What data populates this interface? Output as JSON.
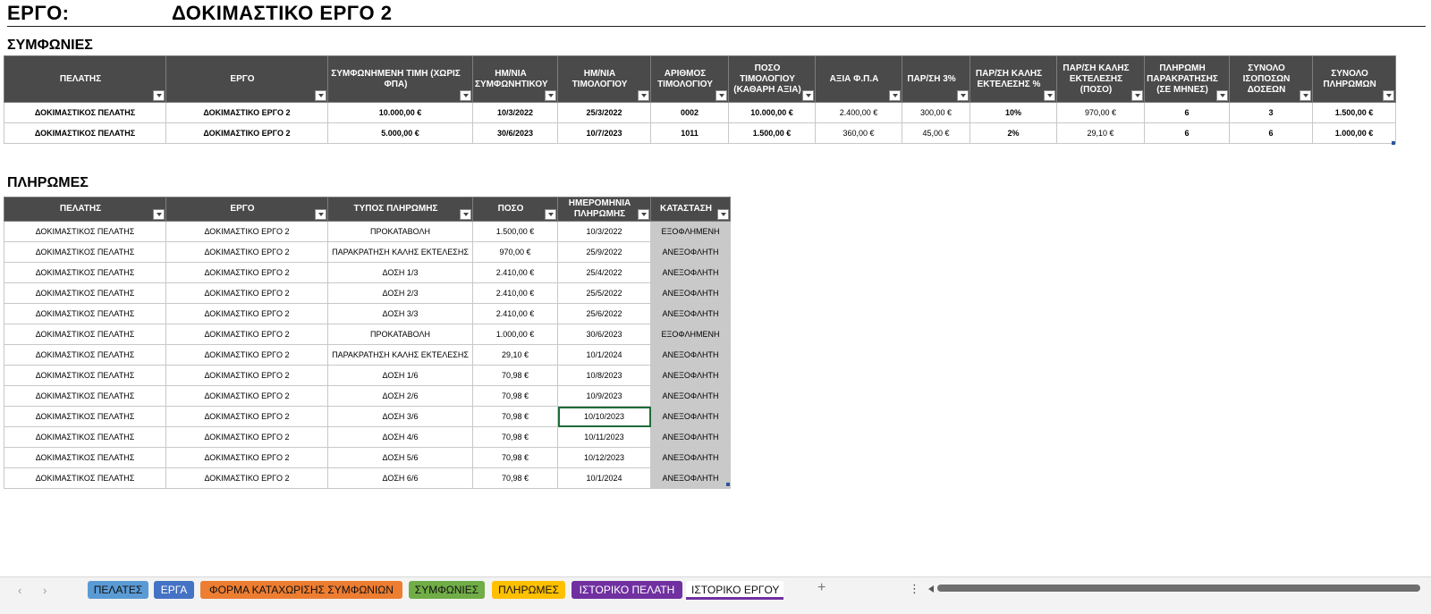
{
  "header": {
    "label": "ΕΡΓΟ:",
    "value": "ΔΟΚΙΜΑΣΤΙΚΟ ΕΡΓΟ 2"
  },
  "agreements": {
    "title": "ΣΥΜΦΩΝΙΕΣ",
    "columns": [
      "ΠΕΛΑΤΗΣ",
      "ΕΡΓΟ",
      "ΣΥΜΦΩΝΗΜΕΝΗ ΤΙΜΗ (ΧΩΡΙΣ ΦΠΑ)",
      "ΗΜ/ΝΙΑ ΣΥΜΦΩΝΗΤΙΚΟΥ",
      "ΗΜ/ΝΙΑ ΤΙΜΟΛΟΓΙΟΥ",
      "ΑΡΙΘΜΟΣ ΤΙΜΟΛΟΓΙΟΥ",
      "ΠΟΣΟ ΤΙΜΟΛΟΓΙΟΥ (ΚΑΘΑΡΗ ΑΞΙΑ)",
      "ΑΞΙΑ Φ.Π.Α",
      "ΠΑΡ/ΣΗ 3%",
      "ΠΑΡ/ΣΗ ΚΑΛΗΣ ΕΚΤΕΛΕΣΗΣ %",
      "ΠΑΡ/ΣΗ ΚΑΛΗΣ ΕΚΤΕΛΕΣΗΣ (ΠΟΣΟ)",
      "ΠΛΗΡΩΜΗ ΠΑΡΑΚΡΑΤΗΣΗΣ (ΣΕ ΜΗΝΕΣ)",
      "ΣΥΝΟΛΟ ΙΣΟΠΟΣΩΝ ΔΟΣΕΩΝ",
      "ΣΥΝΟΛΟ ΠΛΗΡΩΜΩΝ"
    ],
    "rows": [
      [
        "ΔΟΚΙΜΑΣΤΙΚΟΣ ΠΕΛΑΤΗΣ",
        "ΔΟΚΙΜΑΣΤΙΚΟ ΕΡΓΟ 2",
        "10.000,00 €",
        "10/3/2022",
        "25/3/2022",
        "0002",
        "10.000,00 €",
        "2.400,00 €",
        "300,00 €",
        "10%",
        "970,00 €",
        "6",
        "3",
        "1.500,00 €"
      ],
      [
        "ΔΟΚΙΜΑΣΤΙΚΟΣ ΠΕΛΑΤΗΣ",
        "ΔΟΚΙΜΑΣΤΙΚΟ ΕΡΓΟ 2",
        "5.000,00 €",
        "30/6/2023",
        "10/7/2023",
        "1011",
        "1.500,00 €",
        "360,00 €",
        "45,00 €",
        "2%",
        "29,10 €",
        "6",
        "6",
        "1.000,00 €"
      ]
    ]
  },
  "payments": {
    "title": "ΠΛΗΡΩΜΕΣ",
    "columns": [
      "ΠΕΛΑΤΗΣ",
      "ΕΡΓΟ",
      "ΤΥΠΟΣ ΠΛΗΡΩΜΗΣ",
      "ΠΟΣΟ",
      "ΗΜΕΡΟΜΗΝΙΑ ΠΛΗΡΩΜΗΣ",
      "ΚΑΤΑΣΤΑΣΗ"
    ],
    "rows": [
      [
        "ΔΟΚΙΜΑΣΤΙΚΟΣ ΠΕΛΑΤΗΣ",
        "ΔΟΚΙΜΑΣΤΙΚΟ ΕΡΓΟ 2",
        "ΠΡΟΚΑΤΑΒΟΛΗ",
        "1.500,00 €",
        "10/3/2022",
        "ΕΞΟΦΛΗΜΕΝΗ"
      ],
      [
        "ΔΟΚΙΜΑΣΤΙΚΟΣ ΠΕΛΑΤΗΣ",
        "ΔΟΚΙΜΑΣΤΙΚΟ ΕΡΓΟ 2",
        "ΠΑΡΑΚΡΑΤΗΣΗ ΚΑΛΗΣ ΕΚΤΕΛΕΣΗΣ",
        "970,00 €",
        "25/9/2022",
        "ΑΝΕΞΟΦΛΗΤΗ"
      ],
      [
        "ΔΟΚΙΜΑΣΤΙΚΟΣ ΠΕΛΑΤΗΣ",
        "ΔΟΚΙΜΑΣΤΙΚΟ ΕΡΓΟ 2",
        "ΔΟΣΗ 1/3",
        "2.410,00 €",
        "25/4/2022",
        "ΑΝΕΞΟΦΛΗΤΗ"
      ],
      [
        "ΔΟΚΙΜΑΣΤΙΚΟΣ ΠΕΛΑΤΗΣ",
        "ΔΟΚΙΜΑΣΤΙΚΟ ΕΡΓΟ 2",
        "ΔΟΣΗ 2/3",
        "2.410,00 €",
        "25/5/2022",
        "ΑΝΕΞΟΦΛΗΤΗ"
      ],
      [
        "ΔΟΚΙΜΑΣΤΙΚΟΣ ΠΕΛΑΤΗΣ",
        "ΔΟΚΙΜΑΣΤΙΚΟ ΕΡΓΟ 2",
        "ΔΟΣΗ 3/3",
        "2.410,00 €",
        "25/6/2022",
        "ΑΝΕΞΟΦΛΗΤΗ"
      ],
      [
        "ΔΟΚΙΜΑΣΤΙΚΟΣ ΠΕΛΑΤΗΣ",
        "ΔΟΚΙΜΑΣΤΙΚΟ ΕΡΓΟ 2",
        "ΠΡΟΚΑΤΑΒΟΛΗ",
        "1.000,00 €",
        "30/6/2023",
        "ΕΞΟΦΛΗΜΕΝΗ"
      ],
      [
        "ΔΟΚΙΜΑΣΤΙΚΟΣ ΠΕΛΑΤΗΣ",
        "ΔΟΚΙΜΑΣΤΙΚΟ ΕΡΓΟ 2",
        "ΠΑΡΑΚΡΑΤΗΣΗ ΚΑΛΗΣ ΕΚΤΕΛΕΣΗΣ",
        "29,10 €",
        "10/1/2024",
        "ΑΝΕΞΟΦΛΗΤΗ"
      ],
      [
        "ΔΟΚΙΜΑΣΤΙΚΟΣ ΠΕΛΑΤΗΣ",
        "ΔΟΚΙΜΑΣΤΙΚΟ ΕΡΓΟ 2",
        "ΔΟΣΗ 1/6",
        "70,98 €",
        "10/8/2023",
        "ΑΝΕΞΟΦΛΗΤΗ"
      ],
      [
        "ΔΟΚΙΜΑΣΤΙΚΟΣ ΠΕΛΑΤΗΣ",
        "ΔΟΚΙΜΑΣΤΙΚΟ ΕΡΓΟ 2",
        "ΔΟΣΗ 2/6",
        "70,98 €",
        "10/9/2023",
        "ΑΝΕΞΟΦΛΗΤΗ"
      ],
      [
        "ΔΟΚΙΜΑΣΤΙΚΟΣ ΠΕΛΑΤΗΣ",
        "ΔΟΚΙΜΑΣΤΙΚΟ ΕΡΓΟ 2",
        "ΔΟΣΗ 3/6",
        "70,98 €",
        "10/10/2023",
        "ΑΝΕΞΟΦΛΗΤΗ"
      ],
      [
        "ΔΟΚΙΜΑΣΤΙΚΟΣ ΠΕΛΑΤΗΣ",
        "ΔΟΚΙΜΑΣΤΙΚΟ ΕΡΓΟ 2",
        "ΔΟΣΗ 4/6",
        "70,98 €",
        "10/11/2023",
        "ΑΝΕΞΟΦΛΗΤΗ"
      ],
      [
        "ΔΟΚΙΜΑΣΤΙΚΟΣ ΠΕΛΑΤΗΣ",
        "ΔΟΚΙΜΑΣΤΙΚΟ ΕΡΓΟ 2",
        "ΔΟΣΗ 5/6",
        "70,98 €",
        "10/12/2023",
        "ΑΝΕΞΟΦΛΗΤΗ"
      ],
      [
        "ΔΟΚΙΜΑΣΤΙΚΟΣ ΠΕΛΑΤΗΣ",
        "ΔΟΚΙΜΑΣΤΙΚΟ ΕΡΓΟ 2",
        "ΔΟΣΗ 6/6",
        "70,98 €",
        "10/1/2024",
        "ΑΝΕΞΟΦΛΗΤΗ"
      ]
    ],
    "selected_cell": {
      "row": 9,
      "col": 4
    }
  },
  "tabs": [
    {
      "label": "ΠΕΛΑΤΕΣ",
      "color": "#5b9bd5"
    },
    {
      "label": "ΕΡΓΑ",
      "color": "#4472c4"
    },
    {
      "label": "ΦΟΡΜΑ ΚΑΤΑΧΩΡΙΣΗΣ ΣΥΜΦΩΝΙΩΝ",
      "color": "#ed7d31"
    },
    {
      "label": "ΣΥΜΦΩΝΙΕΣ",
      "color": "#70ad47"
    },
    {
      "label": "ΠΛΗΡΩΜΕΣ",
      "color": "#ffc000"
    },
    {
      "label": "ΙΣΤΟΡΙΚΟ ΠΕΛΑΤΗ",
      "color": "#7030a0"
    },
    {
      "label": "ΙΣΤΟΡΙΚΟ ΕΡΓΟΥ",
      "color": "#7030a0",
      "active": true
    }
  ],
  "tabbar": {
    "prev_icon": "‹",
    "next_icon": "›",
    "add_icon": "+",
    "more_icon": "⋮"
  }
}
